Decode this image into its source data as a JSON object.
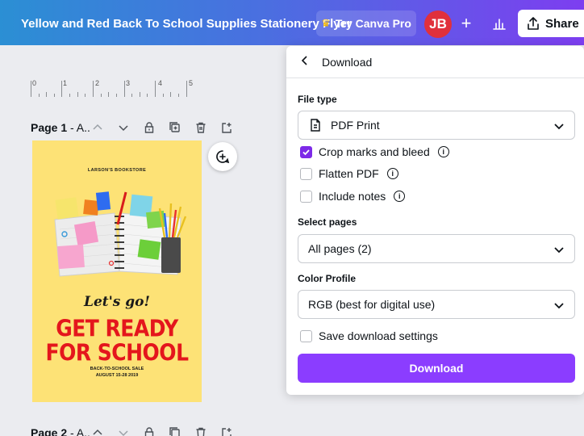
{
  "topbar": {
    "title": "Yellow and Red Back To School Supplies Stationery Flyer",
    "try_pro": "Try Canva Pro",
    "avatar_initials": "JB",
    "plus": "+",
    "share": "Share",
    "gradient_start": "#2b8fd4",
    "gradient_end": "#7d3ef0"
  },
  "ruler": {
    "labels": [
      "0",
      "1",
      "2",
      "3",
      "4",
      "5"
    ]
  },
  "pages": [
    {
      "number": "Page 1",
      "title": " - A.."
    },
    {
      "number": "Page 2",
      "title": " - A.."
    }
  ],
  "flyer": {
    "store": "LARSON'S BOOKSTORE",
    "tagline": "Let's go!",
    "headline_1": "GET READY",
    "headline_2": "FOR SCHOOL",
    "sub_1": "BACK-TO-SCHOOL SALE",
    "sub_2": "AUGUST 15-28 2019",
    "background": "#fde276",
    "headline_color": "#e4161c"
  },
  "download_panel": {
    "title": "Download",
    "file_type_label": "File type",
    "file_type_value": "PDF Print",
    "options": [
      {
        "label": "Crop marks and bleed",
        "checked": true
      },
      {
        "label": "Flatten PDF",
        "checked": false
      },
      {
        "label": "Include notes",
        "checked": false
      }
    ],
    "select_pages_label": "Select pages",
    "select_pages_value": "All pages (2)",
    "color_profile_label": "Color Profile",
    "color_profile_value": "RGB (best for digital use)",
    "save_settings_label": "Save download settings",
    "download_button": "Download",
    "accent": "#8b3dff"
  }
}
